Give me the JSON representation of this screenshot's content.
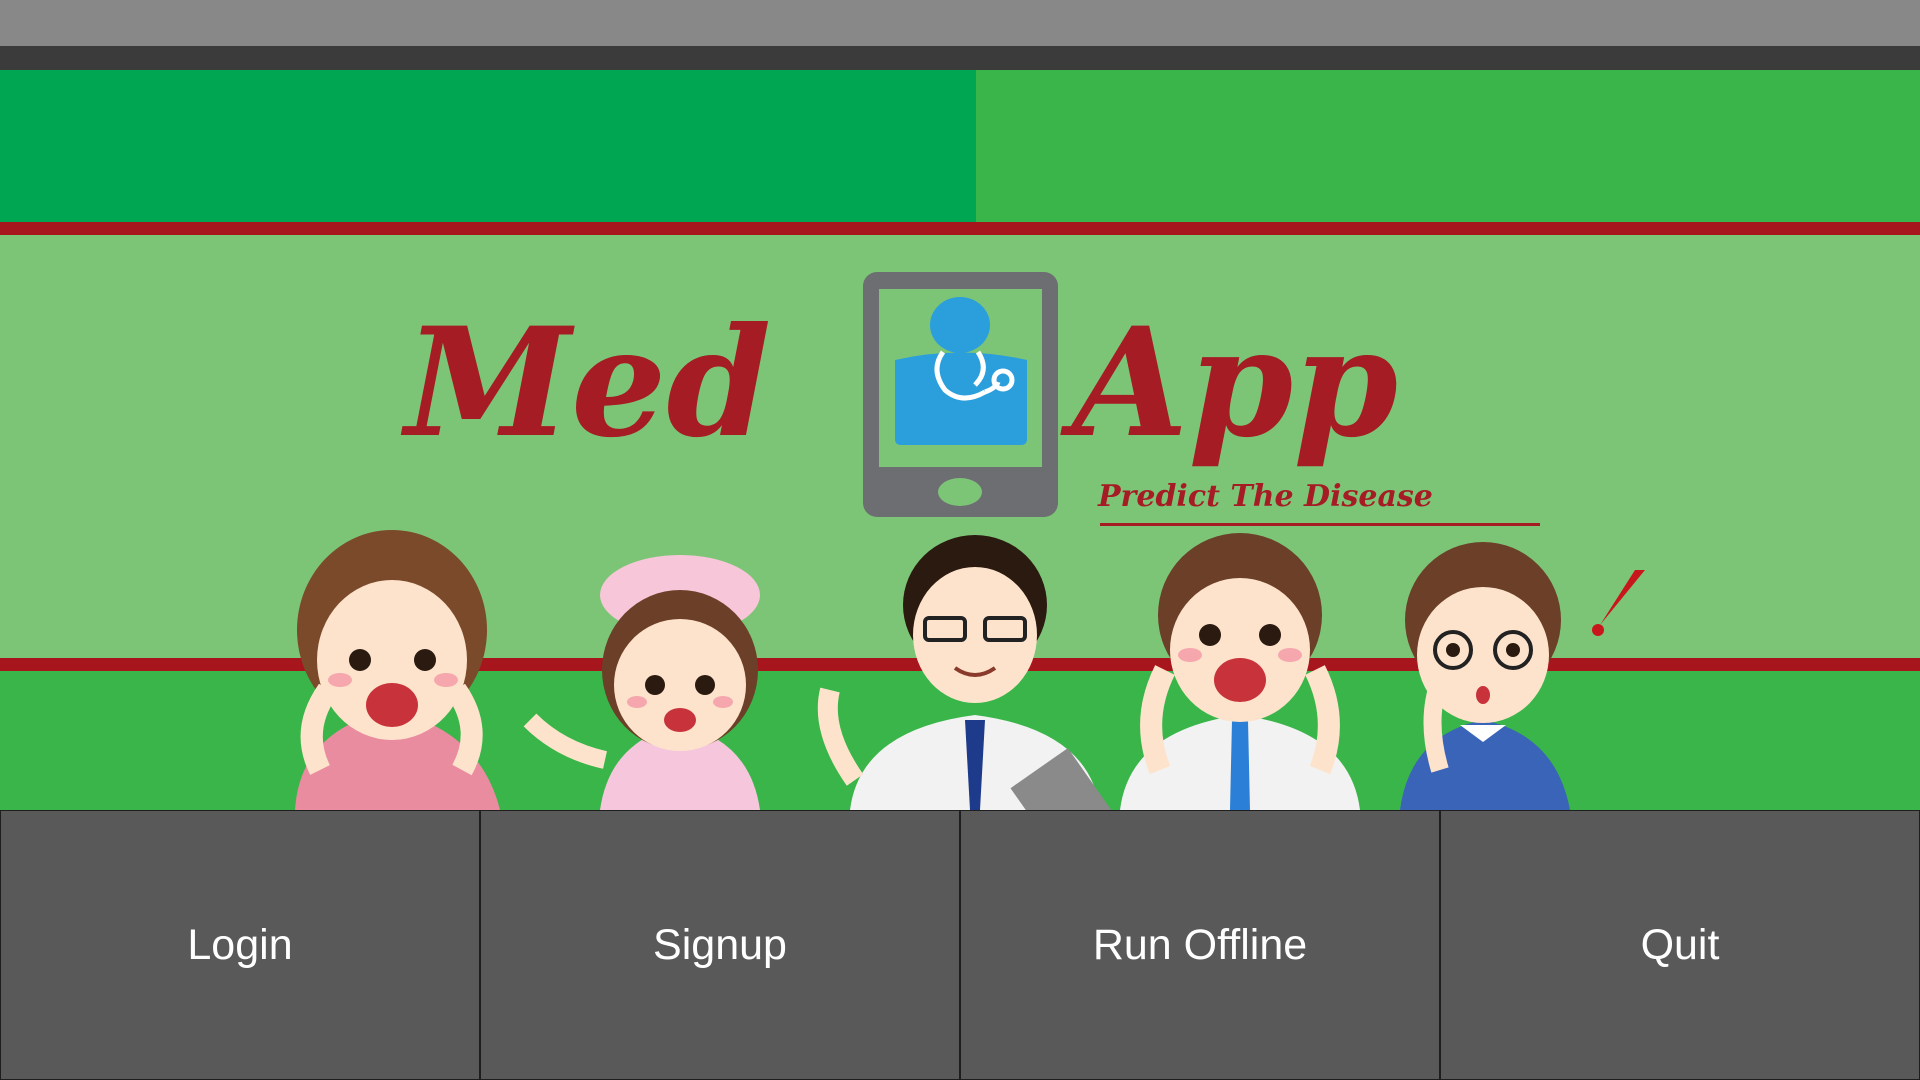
{
  "logo": {
    "word_left": "Med",
    "word_right": "App",
    "tagline": "Predict The Disease",
    "icon": "phone-doctor-icon"
  },
  "characters": [
    {
      "icon": "woman-cheering-icon"
    },
    {
      "icon": "nurse-icon"
    },
    {
      "icon": "doctor-icon"
    },
    {
      "icon": "man-cheering-icon"
    },
    {
      "icon": "boy-surprised-icon"
    }
  ],
  "buttons": [
    {
      "label": "Login"
    },
    {
      "label": "Signup"
    },
    {
      "label": "Run Offline"
    },
    {
      "label": "Quit"
    }
  ],
  "colors": {
    "brand_red": "#a51c24",
    "green_dark": "#00a651",
    "green_mid": "#39b54a",
    "green_light": "#7dc576",
    "button_bg": "#595959"
  }
}
